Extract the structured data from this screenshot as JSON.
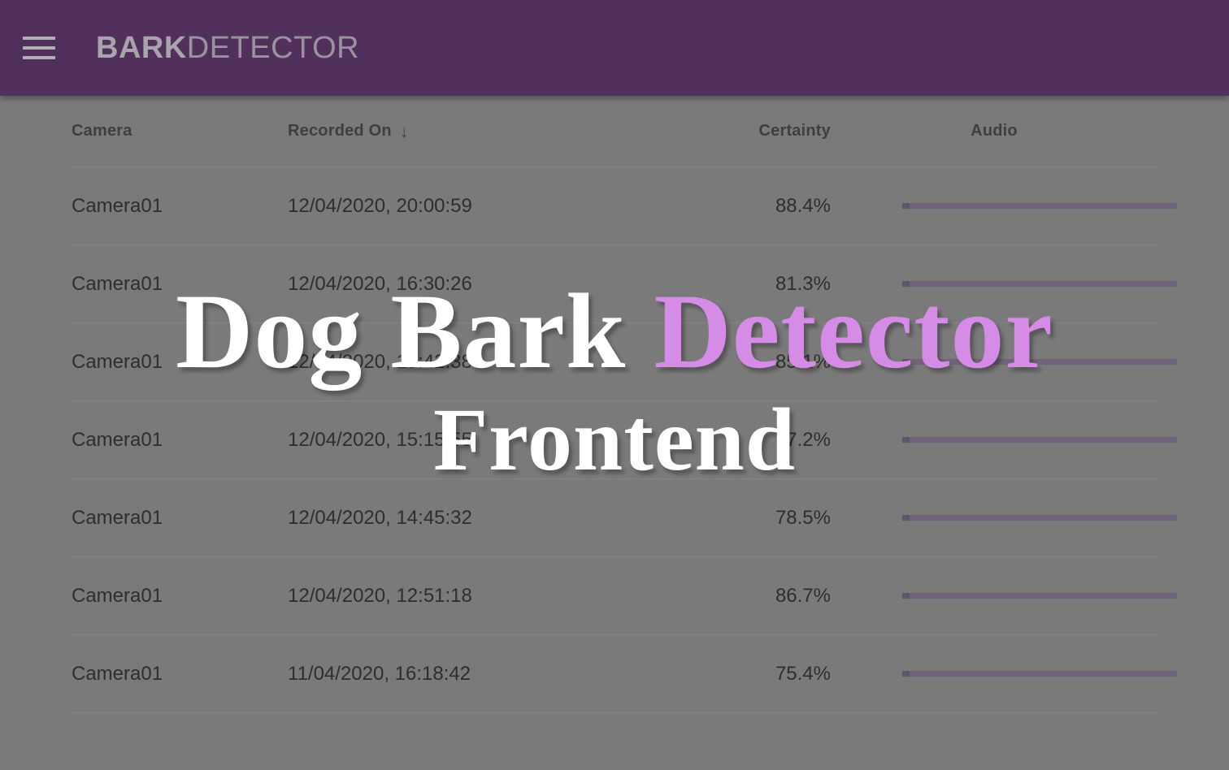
{
  "appbar": {
    "menu_icon": "hamburger-menu-icon",
    "brand_bold": "BARK",
    "brand_light": "DETECTOR",
    "background_color": "#52305c"
  },
  "table": {
    "columns": [
      {
        "key": "camera",
        "label": "Camera",
        "sorted": false
      },
      {
        "key": "recorded",
        "label": "Recorded On",
        "sorted": true,
        "sort_icon": "↓",
        "sort_direction": "descending"
      },
      {
        "key": "certainty",
        "label": "Certainty",
        "sorted": false
      },
      {
        "key": "audio",
        "label": "Audio",
        "sorted": false
      }
    ],
    "rows": [
      {
        "camera": "Camera01",
        "recorded": "12/04/2020, 20:00:59",
        "certainty": "88.4%",
        "audio": "audio-player-bar"
      },
      {
        "camera": "Camera01",
        "recorded": "12/04/2020, 16:30:26",
        "certainty": "81.3%",
        "audio": "audio-player-bar"
      },
      {
        "camera": "Camera01",
        "recorded": "12/04/2020, 15:42:38",
        "certainty": "85.1%",
        "audio": "audio-player-bar"
      },
      {
        "camera": "Camera01",
        "recorded": "12/04/2020, 15:15:55",
        "certainty": "77.2%",
        "audio": "audio-player-bar"
      },
      {
        "camera": "Camera01",
        "recorded": "12/04/2020, 14:45:32",
        "certainty": "78.5%",
        "audio": "audio-player-bar"
      },
      {
        "camera": "Camera01",
        "recorded": "12/04/2020, 12:51:18",
        "certainty": "86.7%",
        "audio": "audio-player-bar"
      },
      {
        "camera": "Camera01",
        "recorded": "11/04/2020, 16:18:42",
        "certainty": "75.4%",
        "audio": "audio-player-bar"
      }
    ]
  },
  "overlay": {
    "title_part1": "Dog Bark ",
    "title_part2": "Detector",
    "subtitle": "Frontend",
    "accent_color": "#d58ce6",
    "text_color": "#ffffff"
  }
}
